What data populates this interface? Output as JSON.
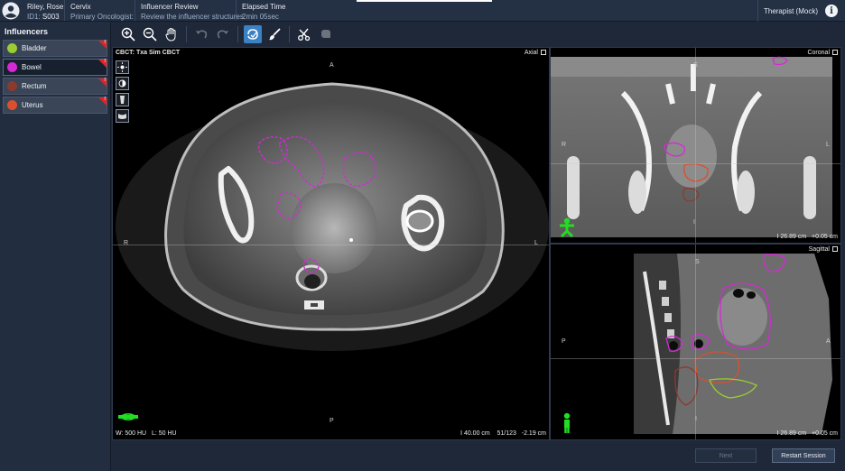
{
  "header": {
    "patient_name": "Riley, Rose",
    "id_label": "ID1:",
    "id_value": "S003",
    "site": "Cervix",
    "oncologist_label": "Primary Oncologist:",
    "step_title": "Influencer Review",
    "step_desc": "Review the influencer structures",
    "elapsed_label": "Elapsed Time",
    "elapsed_value": "2min 05sec",
    "role": "Therapist (Mock)",
    "info_glyph": "i"
  },
  "sidebar": {
    "title": "Influencers",
    "items": [
      {
        "label": "Bladder",
        "color": "#9acd32",
        "flag": "!"
      },
      {
        "label": "Bowel",
        "color": "#d629d6",
        "flag": "!"
      },
      {
        "label": "Rectum",
        "color": "#8b3a2e",
        "flag": "!"
      },
      {
        "label": "Uterus",
        "color": "#d9502e",
        "flag": "!"
      }
    ]
  },
  "toolbar": {
    "icons": [
      "zoom-in-icon",
      "zoom-out-icon",
      "pan-hand-icon",
      "undo-icon",
      "redo-icon",
      "contour-icon",
      "brush-icon",
      "scissors-icon",
      "eraser-icon"
    ]
  },
  "axial": {
    "title": "CBCT: Txa Sim CBCT",
    "name": "Axial",
    "orient_top": "A",
    "orient_bottom": "P",
    "orient_left": "R",
    "orient_right": "L",
    "wl": "W: 500 HU   L: 50 HU",
    "position": "Ⅰ 40.00 cm    51/123   -2.19 cm"
  },
  "coronal": {
    "name": "Coronal",
    "orient_top": "S",
    "orient_bottom": "I",
    "orient_left": "R",
    "orient_right": "L",
    "position": "Ⅰ 26.89 cm   +0.05 cm"
  },
  "sagittal": {
    "name": "Sagittal",
    "orient_top": "S",
    "orient_bottom": "I",
    "orient_left": "P",
    "orient_right": "A",
    "position": "Ⅰ 26.89 cm   +0.05 cm"
  },
  "footer": {
    "next_label": "Next",
    "restart_label": "Restart Session"
  }
}
